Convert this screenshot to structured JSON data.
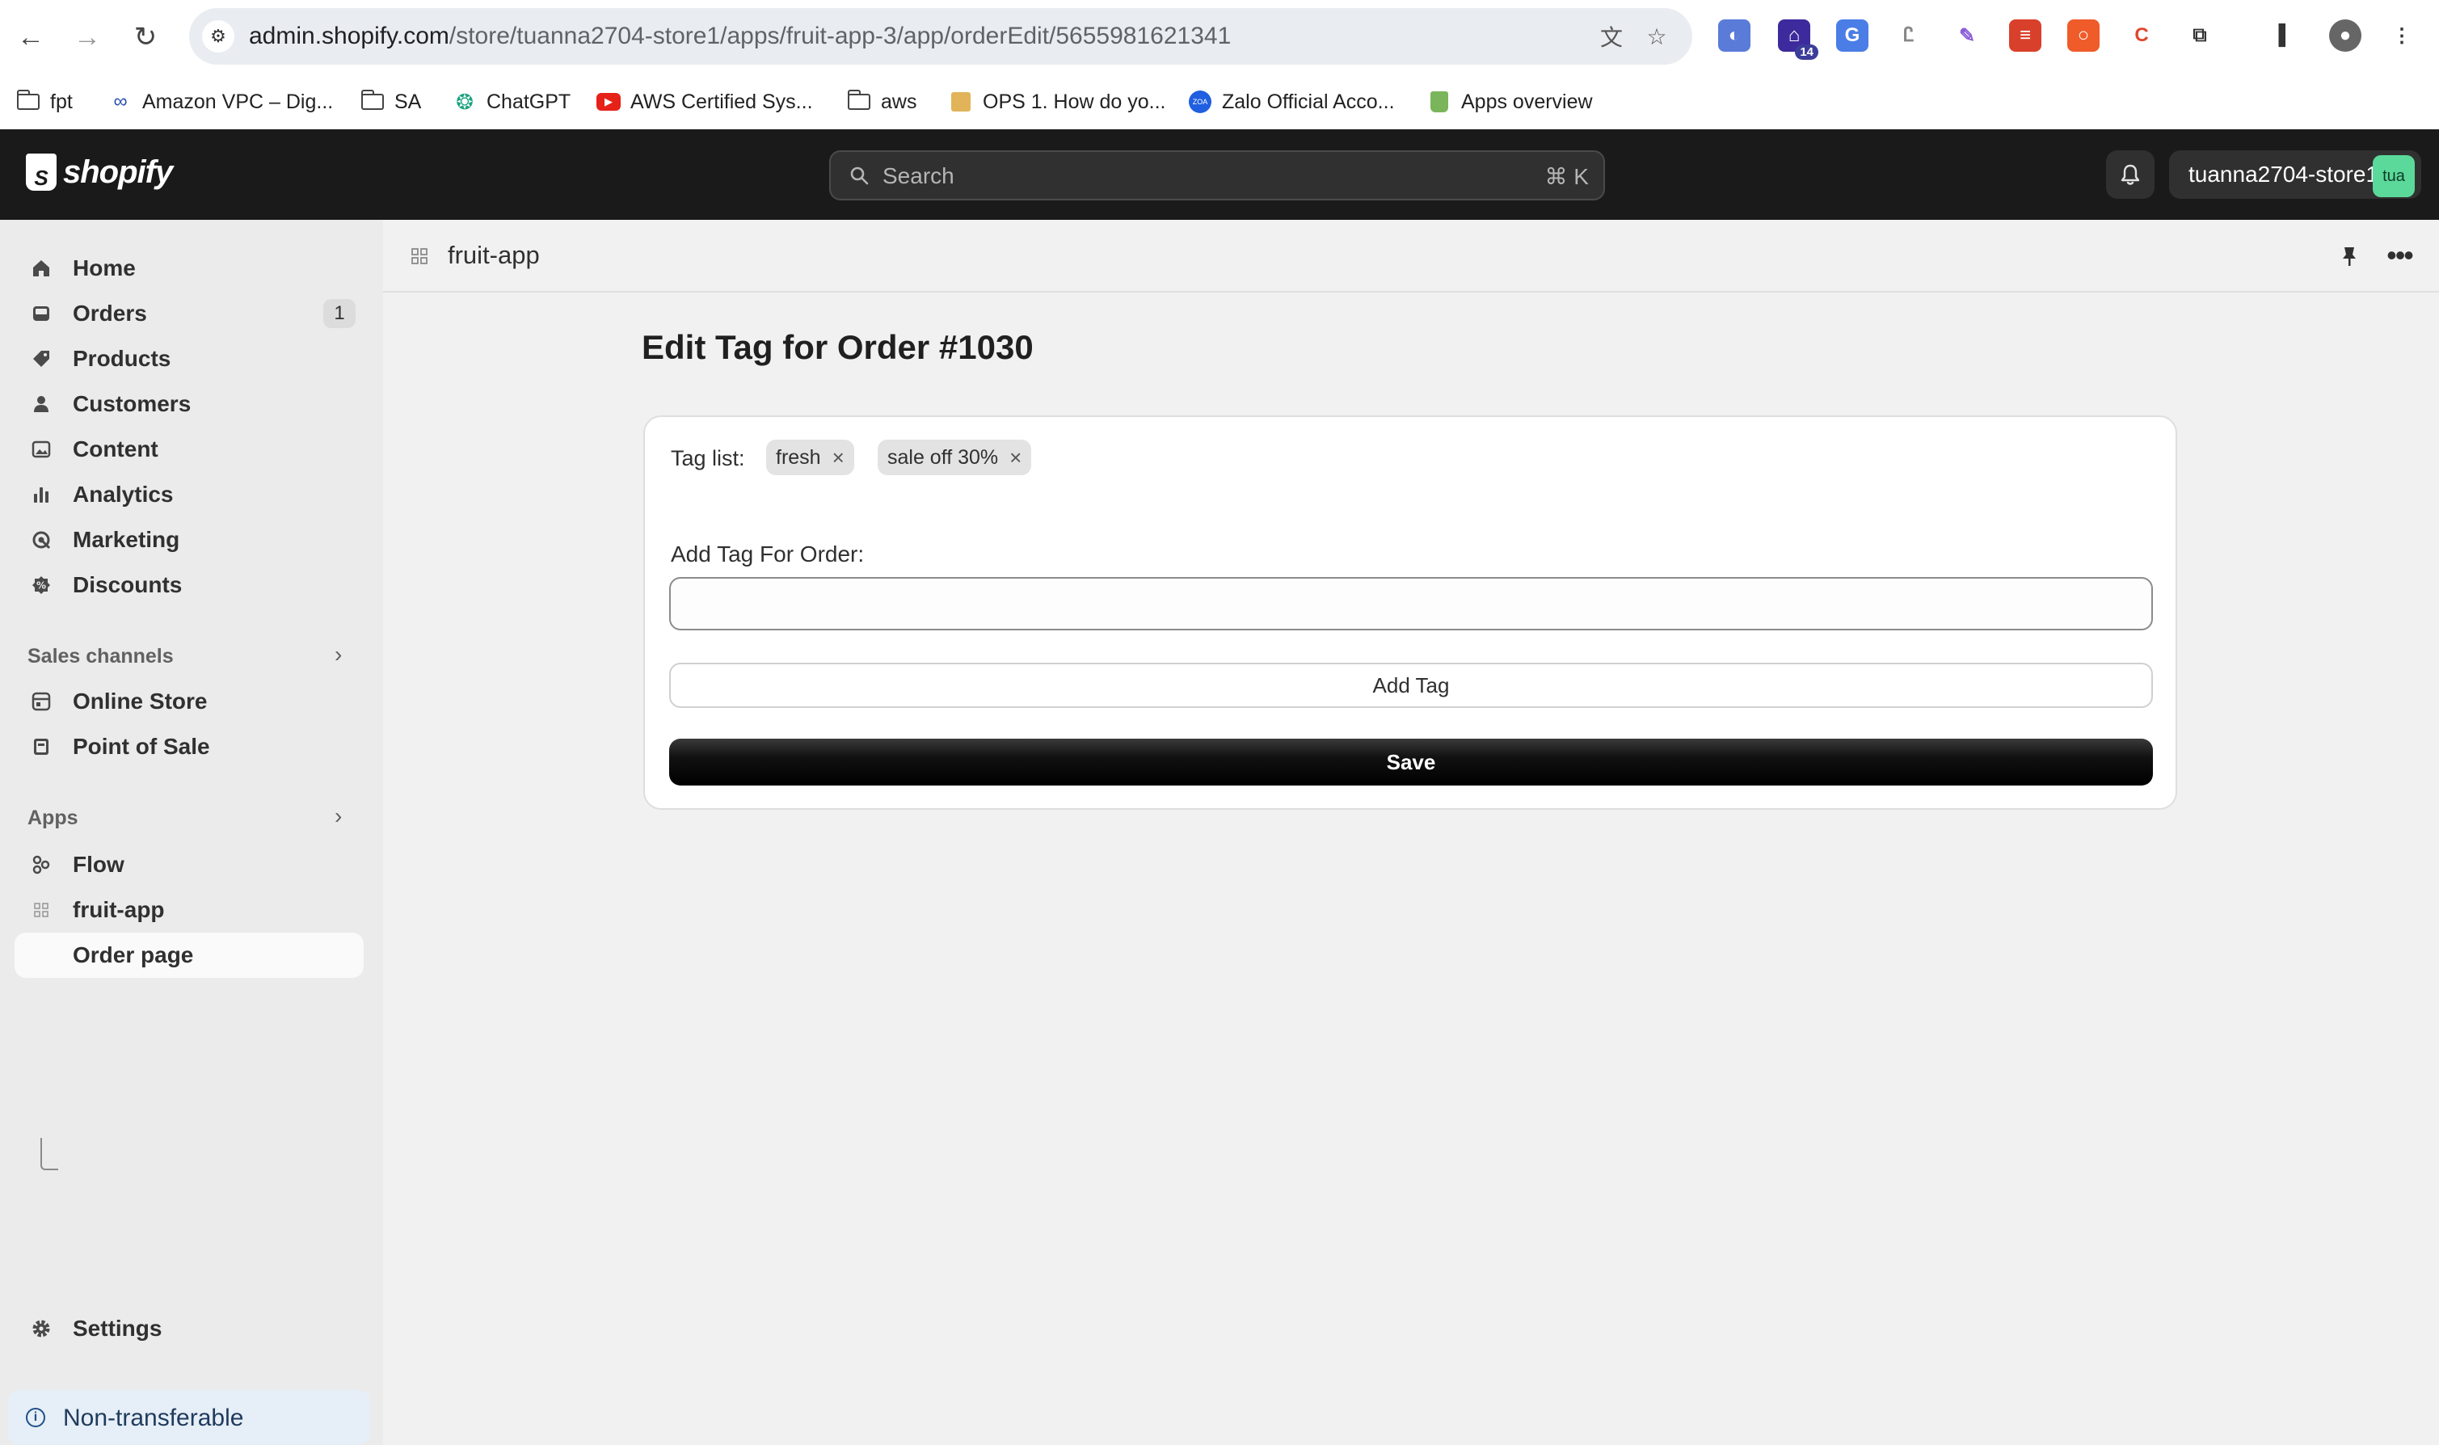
{
  "browser": {
    "url_host": "admin.shopify.com",
    "url_path": "/store/tuanna2704-store1/apps/fruit-app-3/app/orderEdit/5655981621341",
    "extension_badge": "14",
    "bookmarks": [
      {
        "label": "fpt",
        "icon": "folder-icon"
      },
      {
        "label": "Amazon VPC – Dig...",
        "icon": "link-icon"
      },
      {
        "label": "SA",
        "icon": "folder-icon"
      },
      {
        "label": "ChatGPT",
        "icon": "chatgpt-icon"
      },
      {
        "label": "AWS Certified Sys...",
        "icon": "youtube-icon"
      },
      {
        "label": "aws",
        "icon": "folder-icon"
      },
      {
        "label": "OPS 1. How do yo...",
        "icon": "box-icon"
      },
      {
        "label": "Zalo Official Acco...",
        "icon": "zalo-icon"
      },
      {
        "label": "Apps overview",
        "icon": "shopify-icon"
      }
    ]
  },
  "topbar": {
    "brand": "shopify",
    "search_placeholder": "Search",
    "search_shortcut": "⌘ K",
    "store_name": "tuanna2704-store1",
    "avatar_initials": "tua"
  },
  "sidebar": {
    "items": [
      {
        "label": "Home",
        "icon": "home-icon"
      },
      {
        "label": "Orders",
        "icon": "inbox-icon",
        "count": "1"
      },
      {
        "label": "Products",
        "icon": "tag-icon"
      },
      {
        "label": "Customers",
        "icon": "person-icon"
      },
      {
        "label": "Content",
        "icon": "image-icon"
      },
      {
        "label": "Analytics",
        "icon": "bar-chart-icon"
      },
      {
        "label": "Marketing",
        "icon": "target-icon"
      },
      {
        "label": "Discounts",
        "icon": "discount-icon"
      }
    ],
    "sales_channels_title": "Sales channels",
    "sales_channels": [
      {
        "label": "Online Store",
        "icon": "store-icon"
      },
      {
        "label": "Point of Sale",
        "icon": "pos-icon"
      }
    ],
    "apps_title": "Apps",
    "apps": [
      {
        "label": "Flow",
        "icon": "flow-icon"
      },
      {
        "label": "fruit-app",
        "icon": "app-grid-icon"
      },
      {
        "label": "Order page",
        "icon": "subpage-arrow-icon"
      }
    ],
    "settings_label": "Settings",
    "non_transferable_label": "Non-transferable"
  },
  "app_header": {
    "title": "fruit-app"
  },
  "page": {
    "title": "Edit Tag for Order #1030",
    "tag_list_label": "Tag list:",
    "tags": [
      "fresh",
      "sale off 30%"
    ],
    "add_tag_label": "Add Tag For Order:",
    "add_tag_value": "",
    "add_tag_button": "Add Tag",
    "save_button": "Save"
  },
  "colors": {
    "topbar": "#1a1a1a",
    "sidebar": "#ebebeb",
    "canvas": "#f1f1f1",
    "avatar": "#5bd99a",
    "save_button": "#111111"
  }
}
